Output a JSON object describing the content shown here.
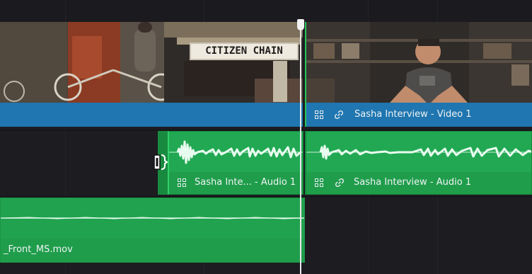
{
  "timeline": {
    "colors": {
      "background": "#1c1c21",
      "video_clip": "#1f76b0",
      "audio_clip": "#22a853",
      "playhead": "#f2f2f2"
    },
    "video_track": {
      "clips": [
        {
          "name": "",
          "icons": []
        },
        {
          "name": "Sasha Interview - Video 1",
          "icons": [
            "clip-stack-icon",
            "link-icon"
          ]
        }
      ],
      "thumbnail_text": "CITIZEN CHAIN"
    },
    "audio_track_1": {
      "clips": [
        {
          "name": "Sasha Inte... - Audio 1",
          "icons": [
            "clip-stack-icon"
          ]
        },
        {
          "name": "Sasha Interview - Audio 1",
          "icons": [
            "clip-stack-icon",
            "link-icon"
          ]
        }
      ],
      "cursor": "trim-cursor-icon"
    },
    "audio_track_2": {
      "clips": [
        {
          "name": "_Front_MS.mov"
        }
      ]
    }
  }
}
